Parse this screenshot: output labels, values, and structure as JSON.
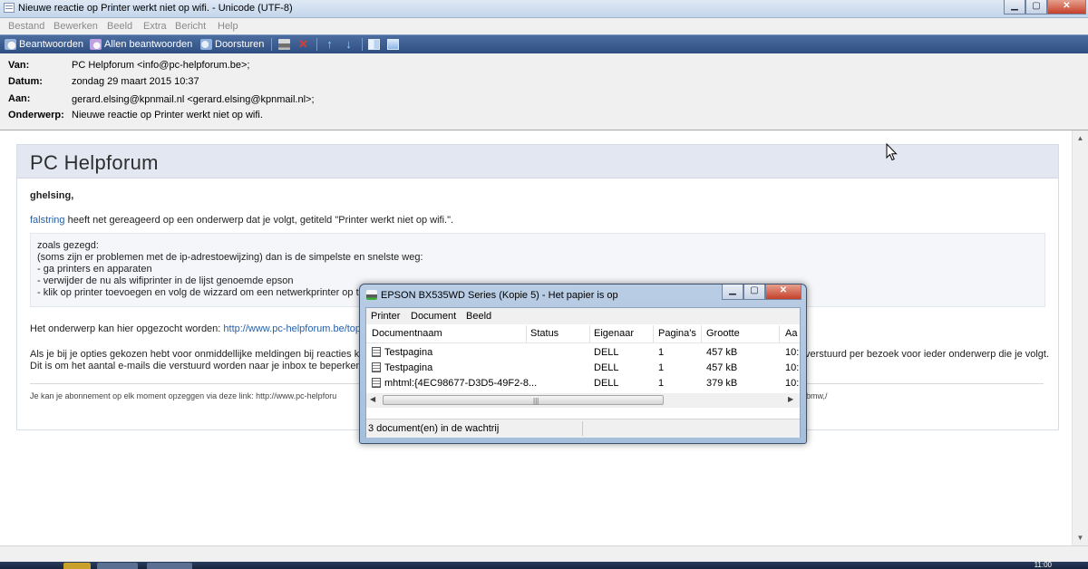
{
  "window": {
    "title": "Nieuwe reactie op Printer werkt niet op wifi. - Unicode (UTF-8)",
    "min": "▁",
    "max": "▢",
    "close": "✕"
  },
  "menu": [
    "Bestand",
    "Bewerken",
    "Beeld",
    "Extra",
    "Bericht",
    "Help"
  ],
  "toolbar": {
    "reply": "Beantwoorden",
    "reply_all": "Allen beantwoorden",
    "forward": "Doorsturen"
  },
  "header": {
    "from_label": "Van:",
    "from": "PC Helpforum <info@pc-helpforum.be>;",
    "date_label": "Datum:",
    "date": "zondag 29 maart 2015 10:37",
    "to_label": "Aan:",
    "to": "gerard.elsing@kpnmail.nl <gerard.elsing@kpnmail.nl>;",
    "subject_label": "Onderwerp:",
    "subject": "Nieuwe reactie op Printer werkt niet op wifi."
  },
  "message": {
    "forum_title": "PC Helpforum",
    "greeting": "ghelsing,",
    "user_link": "falstring",
    "intro": " heeft net gereageerd op een onderwerp dat je volgt, getiteld \"Printer werkt niet op wifi.\".",
    "quote": [
      "zoals gezegd:",
      "(soms zijn er problemen met de ip-adrestoewijzing) dan is de simpelste en snelste weg:",
      "- ga printers en apparaten",
      "- verwijder de nu als wifiprinter in de lijst genoemde epson",
      "- klik op printer toevoegen en volg de wizzard om een netwerkprinter op te"
    ],
    "topic_text": "Het onderwerp kan hier opgezocht worden: ",
    "topic_link": "http://www.pc-helpforum.be/topic",
    "options_line1_a": "Als je bij je opties gekozen hebt voor onmiddellijke meldingen bij reacties ka",
    "options_line1_b": "verstuurd per bezoek voor ieder onderwerp die je volgt.",
    "options_line2": "Dit is om het aantal e-mails die verstuurd worden naar je inbox te beperken.",
    "unsubscribe_a": "Je kan je abonnement op elk moment opzeggen via deze link: http://www.pc-helpforu",
    "unsubscribe_b": "bmw,/"
  },
  "printer_window": {
    "title": "EPSON BX535WD Series (Kopie 5) - Het papier is op",
    "menu": [
      "Printer",
      "Document",
      "Beeld"
    ],
    "columns": [
      "Documentnaam",
      "Status",
      "Eigenaar",
      "Pagina's",
      "Grootte",
      "Aa"
    ],
    "rows": [
      {
        "name": "Testpagina",
        "status": "",
        "owner": "DELL",
        "pages": "1",
        "size": "457 kB",
        "time": "10:"
      },
      {
        "name": "Testpagina",
        "status": "",
        "owner": "DELL",
        "pages": "1",
        "size": "457 kB",
        "time": "10:"
      },
      {
        "name": "mhtml:{4EC98677-D3D5-49F2-8...",
        "status": "",
        "owner": "DELL",
        "pages": "1",
        "size": "379 kB",
        "time": "10:"
      }
    ],
    "scroll_grip": "|||",
    "status": "3 document(en) in de wachtrij"
  },
  "taskbar": {
    "clock": "11:00"
  },
  "colors": {
    "toolbar": "#3a5a8c",
    "link": "#2860a8",
    "forum_header": "#e2e7f1"
  }
}
